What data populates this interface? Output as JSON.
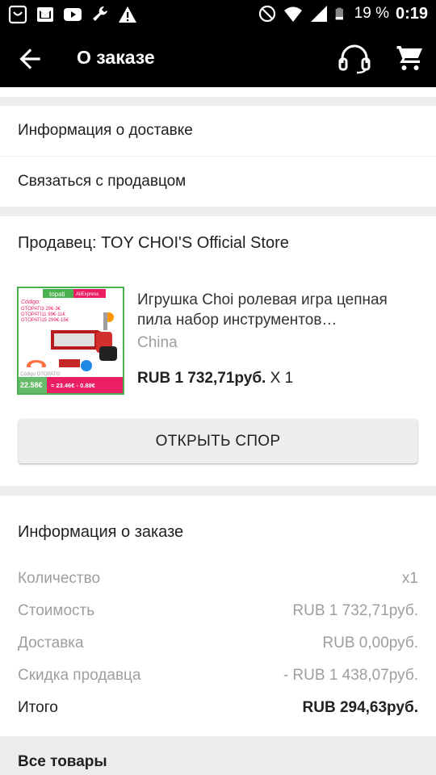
{
  "status_bar": {
    "battery_percent": "19 %",
    "time": "0:19",
    "left_icons": [
      "notification-icon",
      "gmail-icon",
      "youtube-icon",
      "wrench-icon",
      "warning-icon"
    ],
    "right_icons": [
      "do-not-disturb-icon",
      "wifi-icon",
      "signal-icon",
      "battery-icon"
    ]
  },
  "appbar": {
    "title": "О заказе",
    "icons": [
      "back-arrow-icon",
      "headset-icon",
      "cart-icon"
    ]
  },
  "links": {
    "delivery_info": "Информация о доставке",
    "contact_seller": "Связаться с продавцом"
  },
  "seller": {
    "title": "Продавец: TOY CHOI'S Official Store"
  },
  "product": {
    "name": "Игрушка Choi ролевая игра цепная пила набор инструментов…",
    "origin": "China",
    "price": "RUB 1 732,71руб.",
    "quantity_label": " X 1",
    "image": {
      "brand": "topati",
      "store_label": "AliExpress",
      "coupon_heading": "Código:",
      "coupons": [
        "OTOPATI3 29€-3€",
        "OTOPATI11 99€-11€",
        "OTOPATI15 299€-15€"
      ],
      "old_price": "22.58€",
      "new_price": "= 23.46€ - 0.88€",
      "code_label": "Código OTOPATI3"
    }
  },
  "dispute_button": "ОТКРЫТЬ СПОР",
  "order_info": {
    "title": "Информация о заказе",
    "rows": [
      {
        "label": "Количество",
        "value": "x1"
      },
      {
        "label": "Стоимость",
        "value": "RUB 1 732,71руб."
      },
      {
        "label": "Доставка",
        "value": "RUB 0,00руб."
      },
      {
        "label": "Скидка продавца",
        "value": "- RUB 1 438,07руб."
      }
    ],
    "total": {
      "label": "Итого",
      "value": "RUB 294,63руб."
    }
  },
  "all_goods": "Все товары",
  "colors": {
    "appbar": "#000000",
    "background": "#ededed",
    "muted_text": "#9e9e9e",
    "button_bg": "#eeeeee",
    "image_border": "#4caf50",
    "image_pink": "#e91e63"
  }
}
